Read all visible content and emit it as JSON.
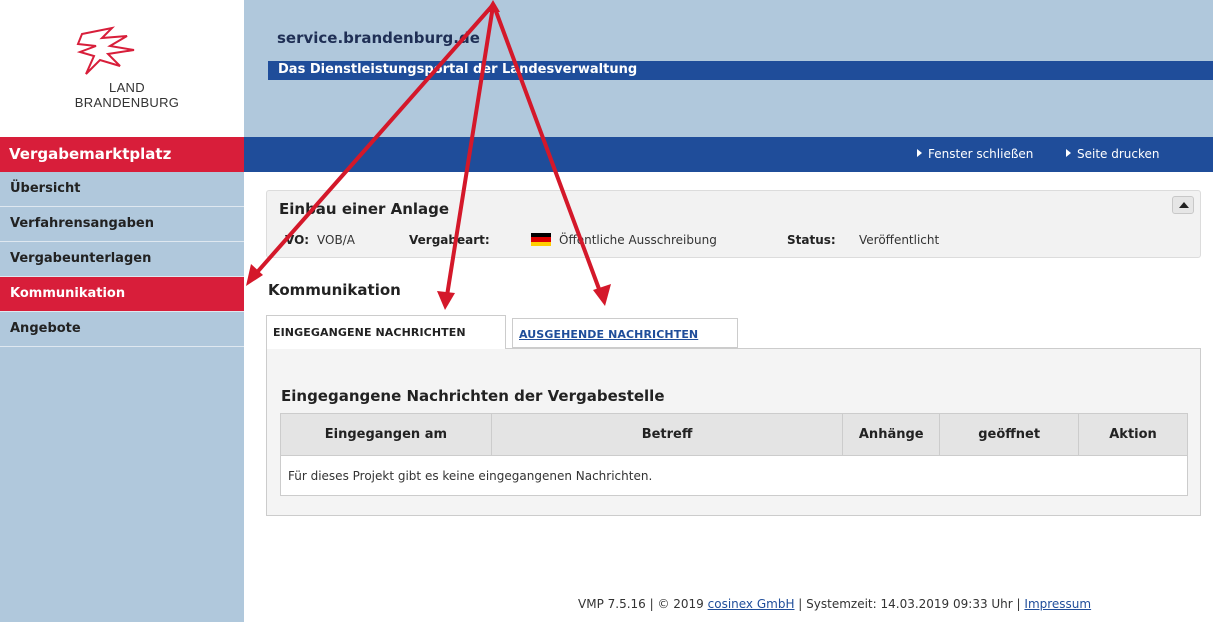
{
  "logo": {
    "line1": "LAND",
    "line2": "BRANDENBURG"
  },
  "header": {
    "site_name": "service.brandenburg.de",
    "portal_subtitle": "Das Dienstleistungsportal der Landesverwaltung"
  },
  "app_title": "Vergabemarktplatz",
  "nav": {
    "close_window": "Fenster schließen",
    "print_page": "Seite drucken"
  },
  "sidebar": {
    "items": [
      {
        "label": "Übersicht",
        "active": false
      },
      {
        "label": "Verfahrensangaben",
        "active": false
      },
      {
        "label": "Vergabeunterlagen",
        "active": false
      },
      {
        "label": "Kommunikation",
        "active": true
      },
      {
        "label": "Angebote",
        "active": false
      }
    ]
  },
  "project": {
    "title": "Einbau einer Anlage",
    "vo_label": "VO:",
    "vo_value": "VOB/A",
    "vergabeart_label": "Vergabeart:",
    "vergabeart_value": "Öffentliche Ausschreibung",
    "status_label": "Status:",
    "status_value": "Veröffentlicht"
  },
  "communication": {
    "heading": "Kommunikation",
    "tabs": [
      {
        "label": "EINGEGANGENE NACHRICHTEN",
        "active": true
      },
      {
        "label": "AUSGEHENDE NACHRICHTEN",
        "active": false
      }
    ],
    "panel_heading": "Eingegangene Nachrichten der Vergabestelle",
    "columns": [
      "Eingegangen am",
      "Betreff",
      "Anhänge",
      "geöffnet",
      "Aktion"
    ],
    "empty_message": "Für dieses Projekt gibt es keine eingegangenen Nachrichten."
  },
  "footer": {
    "version": "VMP 7.5.16 | © 2019 ",
    "company": "cosinex GmbH",
    "systemtime": " | Systemzeit: 14.03.2019 09:33 Uhr | ",
    "impressum": "Impressum"
  },
  "colors": {
    "accent_red": "#d81e3a",
    "nav_blue": "#1f4d9a",
    "header_blue": "#b0c8dc",
    "annotation_arrow": "#d4182a"
  }
}
